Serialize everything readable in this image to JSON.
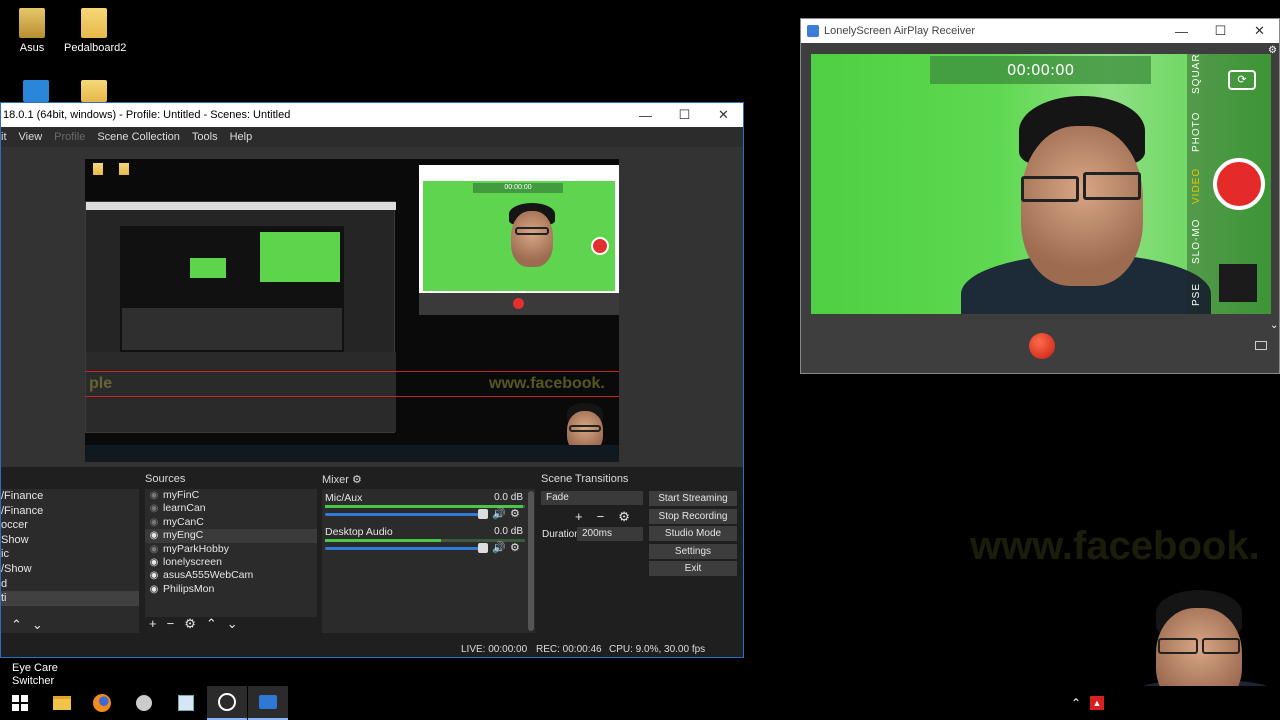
{
  "desktop": {
    "icons": [
      {
        "label": "Asus"
      },
      {
        "label": "Pedalboard2"
      }
    ],
    "watermark_left": "ple",
    "watermark_right": "www.facebook."
  },
  "obs": {
    "title": "18.0.1 (64bit, windows) - Profile: Untitled - Scenes: Untitled",
    "menu": [
      "it",
      "View",
      "Profile",
      "Scene Collection",
      "Tools",
      "Help"
    ],
    "preview": {
      "nested_timer": "00:00:00",
      "fb_text": "www.facebook.",
      "ple_text": "ple"
    },
    "scenes": {
      "items": [
        "/Finance",
        "/Finance",
        "occer",
        "Show",
        "ic",
        "/Show",
        "d",
        "ti"
      ],
      "selected_index": 7
    },
    "sources": {
      "label": "Sources",
      "items": [
        {
          "name": "myFinC",
          "visible": false
        },
        {
          "name": "learnCan",
          "visible": false
        },
        {
          "name": "myCanC",
          "visible": false
        },
        {
          "name": "myEngC",
          "visible": true
        },
        {
          "name": "myParkHobby",
          "visible": false
        },
        {
          "name": "lonelyscreen",
          "visible": true
        },
        {
          "name": "asusA555WebCam",
          "visible": true
        },
        {
          "name": "PhilipsMon",
          "visible": true
        }
      ],
      "selected_index": 3
    },
    "mixer": {
      "label": "Mixer",
      "channels": [
        {
          "name": "Mic/Aux",
          "db": "0.0 dB",
          "meter": 0.99
        },
        {
          "name": "Desktop Audio",
          "db": "0.0 dB",
          "meter": 0.58
        }
      ]
    },
    "transitions": {
      "label": "Scene Transitions",
      "selected": "Fade",
      "duration_label": "Duration",
      "duration_value": "200ms"
    },
    "controls": [
      "Start Streaming",
      "Stop Recording",
      "Studio Mode",
      "Settings",
      "Exit"
    ],
    "status": {
      "live": "LIVE: 00:00:00",
      "rec": "REC: 00:00:46",
      "cpu": "CPU: 9.0%, 30.00 fps"
    }
  },
  "lonely": {
    "title": "LonelyScreen AirPlay Receiver",
    "timer": "00:00:00",
    "modes": [
      "SQUARE",
      "PHOTO",
      "VIDEO",
      "SLO-MO",
      "PSE"
    ],
    "active_mode": "VIDEO"
  },
  "taskbar": {
    "eyecare_line1": "Eye Care",
    "eyecare_line2": "Switcher"
  },
  "colors": {
    "obs_bg": "#1f1f1f",
    "green_screen": "#5ed850",
    "record_red": "#e52a2a",
    "active_mode": "#f2c200"
  }
}
